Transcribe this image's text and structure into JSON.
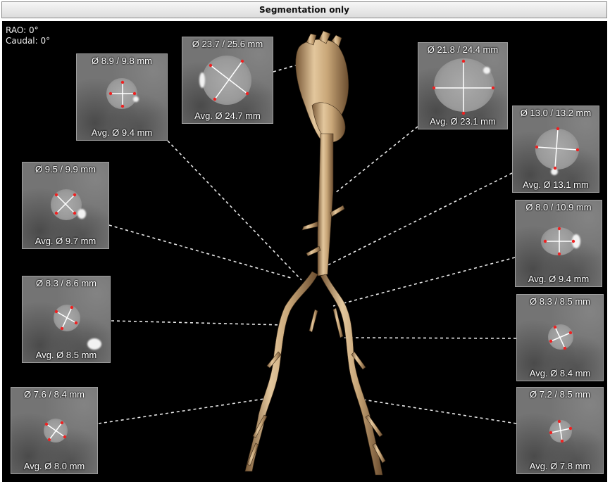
{
  "header": {
    "title": "Segmentation only"
  },
  "view": {
    "rao": "RAO: 0°",
    "caudal": "Caudal: 0°"
  },
  "panels": [
    {
      "id": "p1",
      "top": "Ø 8.9 / 9.8 mm",
      "bottom": "Avg. Ø 9.4 mm"
    },
    {
      "id": "p2",
      "top": "Ø 23.7 / 25.6 mm",
      "bottom": "Avg. Ø 24.7 mm"
    },
    {
      "id": "p3",
      "top": "Ø 21.8 / 24.4 mm",
      "bottom": "Avg. Ø 23.1 mm"
    },
    {
      "id": "p4",
      "top": "Ø 9.5 / 9.9 mm",
      "bottom": "Avg. Ø 9.7 mm"
    },
    {
      "id": "p5",
      "top": "Ø 13.0 / 13.2 mm",
      "bottom": "Avg. Ø 13.1 mm"
    },
    {
      "id": "p6",
      "top": "Ø 8.0 / 10.9 mm",
      "bottom": "Avg. Ø 9.4 mm"
    },
    {
      "id": "p7",
      "top": "Ø 8.3 / 8.6 mm",
      "bottom": "Avg. Ø 8.5 mm"
    },
    {
      "id": "p8",
      "top": "Ø 8.3 / 8.5 mm",
      "bottom": "Avg. Ø 8.4 mm"
    },
    {
      "id": "p9",
      "top": "Ø 7.6 / 8.4 mm",
      "bottom": "Avg. Ø 8.0 mm"
    },
    {
      "id": "p10",
      "top": "Ø 7.2 / 8.5 mm",
      "bottom": "Avg. Ø 7.8 mm"
    }
  ]
}
